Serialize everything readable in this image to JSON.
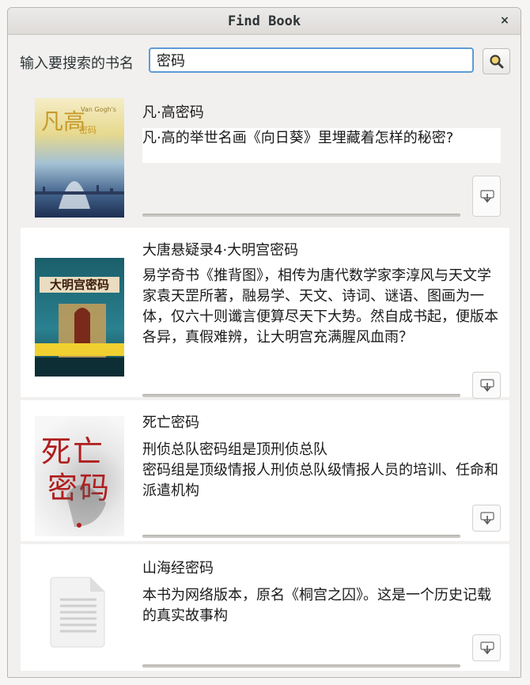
{
  "window": {
    "title": "Find Book",
    "close_glyph": "×"
  },
  "search": {
    "label": "输入要搜索的书名",
    "value": "密码",
    "button_icon": "magnifier-icon"
  },
  "books": [
    {
      "title": "凡·高密码",
      "description": "凡·高的举世名画《向日葵》里埋藏着怎样的秘密?",
      "cover": {
        "text": "凡高",
        "subtext": "密码",
        "label": "Van Gogh's",
        "colors": [
          "#f0e6b0",
          "#8fb3cc",
          "#2a3f66"
        ]
      },
      "download_icon": "download-icon"
    },
    {
      "title": "大唐悬疑录4·大明宫密码",
      "description": "易学奇书《推背图》，相传为唐代数学家李淳风与天文学家袁天罡所著，融易学、天文、诗词、谜语、图画为一体，仅六十则谶言便算尽天下大势。然自成书起，便版本各异，真假难辨，让大明宫充满腥风血雨？",
      "cover": {
        "text": "大明宫密码",
        "colors": [
          "#1d6f7c",
          "#c89a4a",
          "#7a2a1a"
        ]
      },
      "download_icon": "download-icon"
    },
    {
      "title": "死亡密码",
      "description": "刑侦总队密码组是顶刑侦总队\n密码组是顶级情报人刑侦总队级情报人员的培训、任命和派遣机构",
      "cover": {
        "text_top": "死亡",
        "text_bottom": "密码",
        "colors": [
          "#ececec",
          "#b01e1e",
          "#333333"
        ]
      },
      "download_icon": "download-icon"
    },
    {
      "title": "山海经密码",
      "description": "本书为网络版本，原名《桐宫之囚》。这是一个历史记载的真实故事构",
      "cover": {
        "placeholder_icon": "document-icon"
      },
      "download_icon": "download-icon"
    }
  ]
}
